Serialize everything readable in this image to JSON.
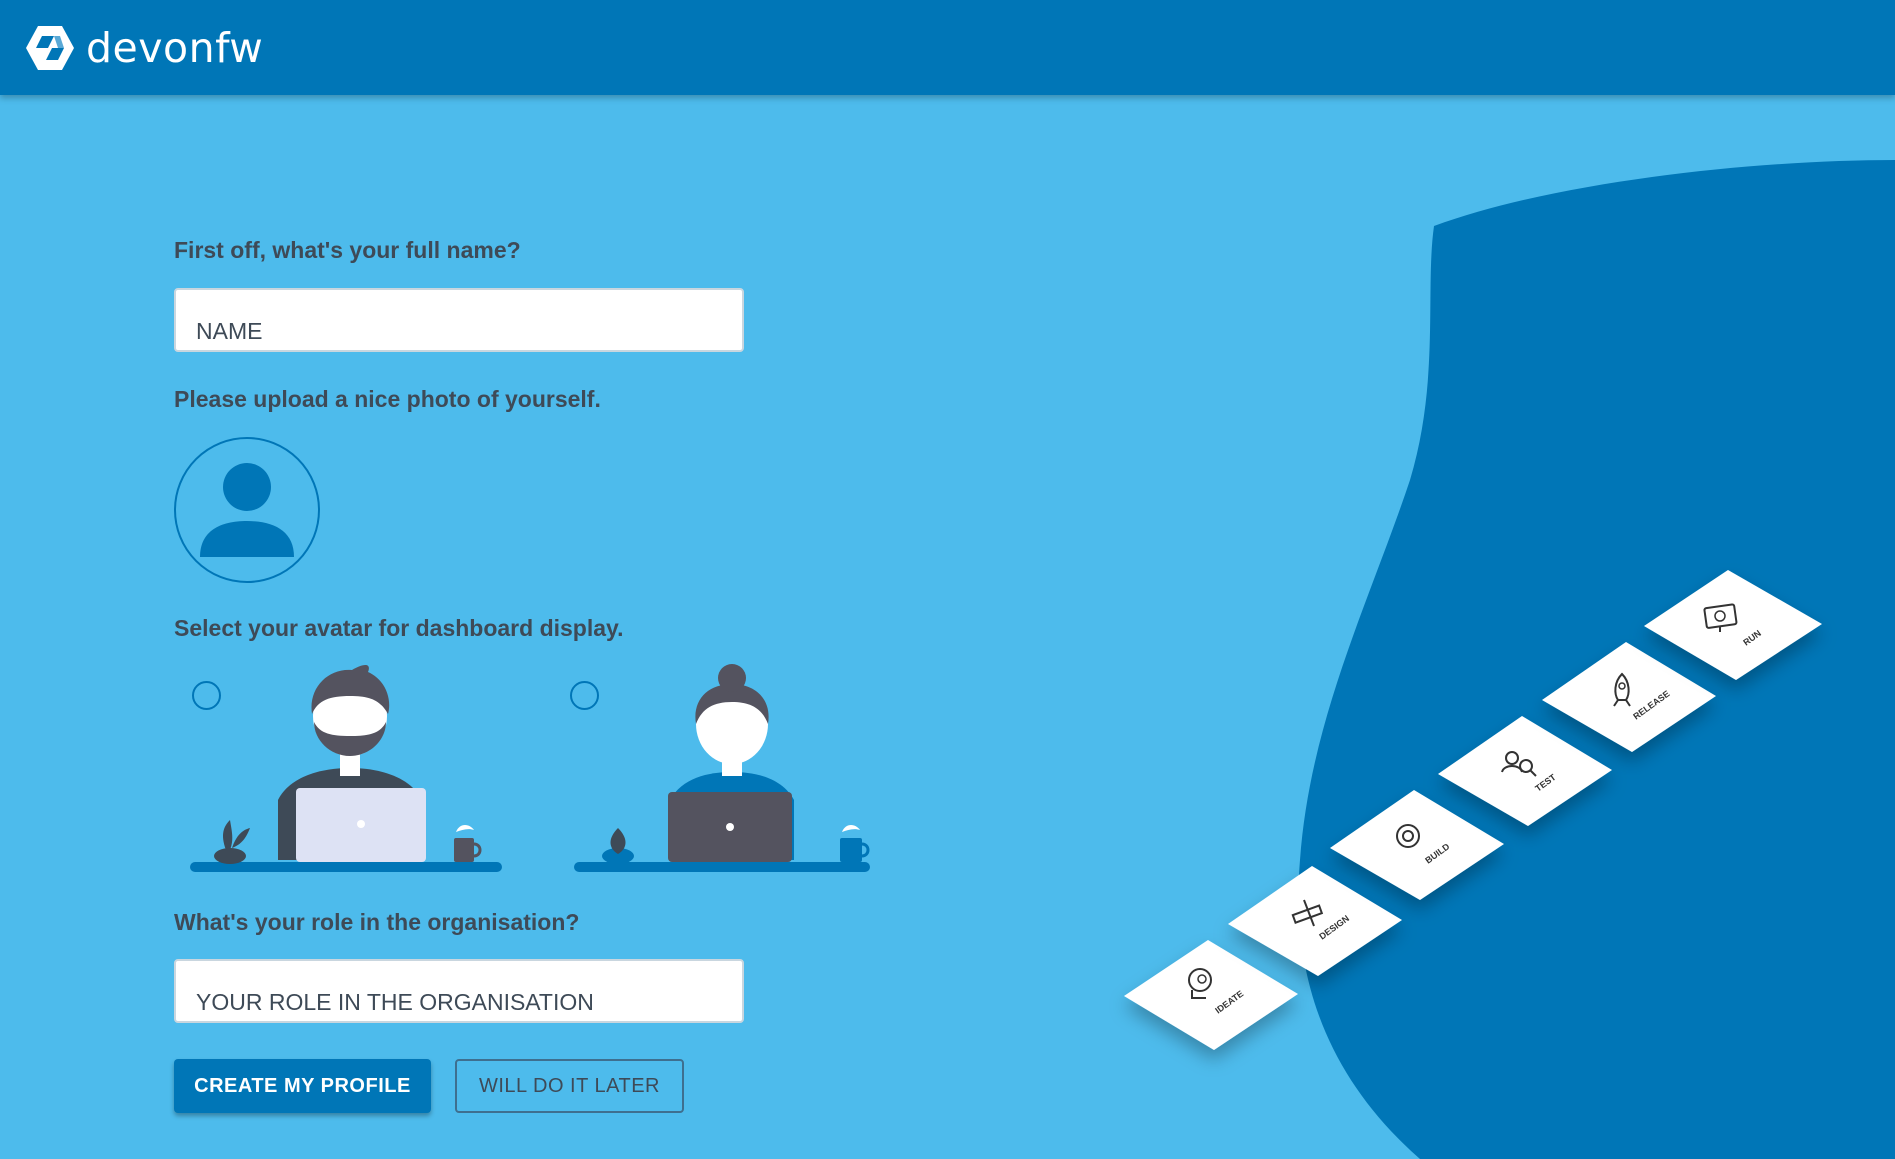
{
  "header": {
    "brand": "devonfw",
    "background": "#0076b7",
    "logo_icon": "devonfw-cube-icon"
  },
  "form": {
    "name_question": "First off, what's your full name?",
    "name_placeholder": "NAME",
    "photo_question": "Please upload a nice photo of yourself.",
    "photo_icon": "user-silhouette-icon",
    "avatar_question": "Select your avatar for dashboard display.",
    "avatars": [
      {
        "name": "male-avatar",
        "selected": false
      },
      {
        "name": "female-avatar",
        "selected": false
      }
    ],
    "role_question": "What's your role in the organisation?",
    "role_placeholder": "YOUR ROLE IN THE ORGANISATION"
  },
  "actions": {
    "create_label": "CREATE MY PROFILE",
    "later_label": "WILL DO IT LATER"
  },
  "steps": [
    {
      "label": "IDEATE",
      "icon": "head-bulb-icon"
    },
    {
      "label": "DESIGN",
      "icon": "ruler-pencil-icon"
    },
    {
      "label": "BUILD",
      "icon": "gears-icon"
    },
    {
      "label": "TEST",
      "icon": "person-magnifier-icon"
    },
    {
      "label": "RELEASE",
      "icon": "rocket-icon"
    },
    {
      "label": "RUN",
      "icon": "monitor-icon"
    }
  ],
  "colors": {
    "page_background": "#4dbbec",
    "accent": "#0076b7",
    "text": "#3e4a57"
  }
}
